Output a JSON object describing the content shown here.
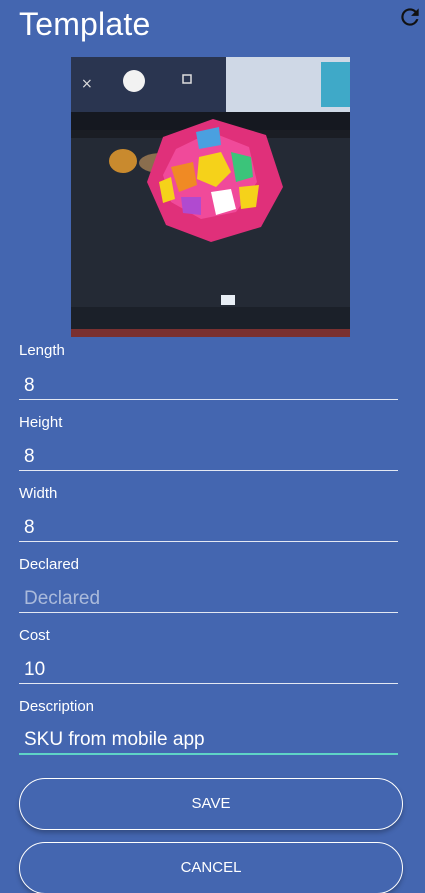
{
  "header": {
    "title": "Template",
    "refresh_icon": "refresh-icon"
  },
  "photo": {
    "subject": "product-photo-icon"
  },
  "form": {
    "length": {
      "label": "Length",
      "value": "8",
      "placeholder": ""
    },
    "height": {
      "label": "Height",
      "value": "8",
      "placeholder": ""
    },
    "width": {
      "label": "Width",
      "value": "8",
      "placeholder": ""
    },
    "declared": {
      "label": "Declared",
      "value": "",
      "placeholder": "Declared"
    },
    "cost": {
      "label": "Cost",
      "value": "10",
      "placeholder": ""
    },
    "description": {
      "label": "Description",
      "value": "SKU from mobile app",
      "placeholder": ""
    }
  },
  "buttons": {
    "save": "SAVE",
    "cancel": "CANCEL"
  },
  "colors": {
    "background": "#4466b0",
    "focus_underline": "#5fd4c6",
    "text": "#ffffff"
  }
}
